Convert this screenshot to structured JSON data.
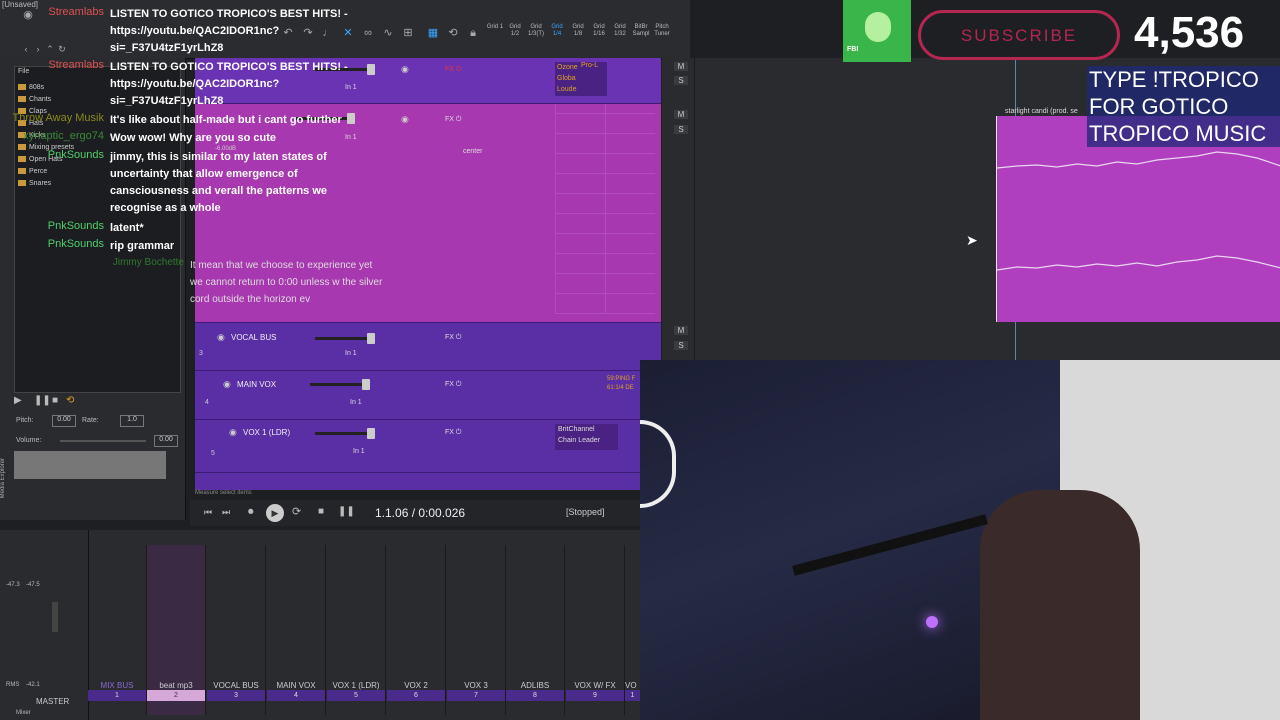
{
  "toolbar": {
    "title": "[Unsaved]",
    "grid_labels": [
      "Grid 1",
      "Grid 1/2",
      "Grid 1/3(T)",
      "Grid 1/4",
      "Grid 1/8",
      "Grid 1/16",
      "Grid 1/32",
      "BitBr Sampl",
      "Pitch Tuner"
    ]
  },
  "browser": {
    "tab": "File",
    "folders": [
      "808s",
      "Chants",
      "Claps",
      "Hats",
      "Kicks",
      "Mixing presets",
      "Open Hats",
      "Perce",
      "Snares"
    ],
    "pitch_label": "Pitch:",
    "pitch_value": "0.00",
    "rate_label": "Rate:",
    "rate_value": "1.0",
    "volume_label": "Volume:",
    "volume_value": "0.00",
    "side_label": "Media Explorer"
  },
  "chat": [
    {
      "name": "Streamlabs",
      "message": "LISTEN TO GOTICO TROPICO'S BEST HITS! - https://youtu.be/QAC2IDOR1nc?si=_F37U4tzF1yrLhZ8"
    },
    {
      "name": "Streamlabs",
      "message": "LISTEN TO GOTICO TROPICO'S BEST HITS! - https://youtu.be/QAC2IDOR1nc?si=_F37U4tzF1yrLhZ8"
    },
    {
      "name": "Throw Away Musik",
      "message": "It's like about half-made but i cant go further"
    },
    {
      "name": "xynaptic_ergo74",
      "message": "Wow wow! Why are you so cute"
    },
    {
      "name": "PnkSounds",
      "message": "jimmy, this is similar to my laten states of uncertainty that allow emergence of cansciousness and verall the patterns we recognise as a whole"
    },
    {
      "name": "PnkSounds",
      "message": "latent*"
    },
    {
      "name": "PnkSounds",
      "message": "rip grammar"
    },
    {
      "name": "Jimmy Bochette",
      "message": "It mean that we choose to experience yet we cannot return to 0:00 unless w the silver cord outside the horizon ev"
    }
  ],
  "tracks": [
    {
      "num": "",
      "name": "",
      "input": "In 1",
      "plugins": [
        "Ozone",
        "Pro-L",
        "Globa",
        "Loude"
      ]
    },
    {
      "num": "",
      "name": "",
      "input": "In 1",
      "pan": "center",
      "vol": "-6.00dB"
    },
    {
      "num": "3",
      "name": "VOCAL BUS",
      "input": "In 1"
    },
    {
      "num": "4",
      "name": "MAIN VOX",
      "input": "In 1",
      "plugins": [
        "59:PING F",
        "61:1/4 DE"
      ]
    },
    {
      "num": "5",
      "name": "VOX 1 (LDR)",
      "input": "In 1",
      "plugins": [
        "BritChannel",
        "Chain Leader"
      ]
    }
  ],
  "arrange": {
    "clip_label": "starlight candi (prod. se",
    "hint": "Measure select items"
  },
  "transport": {
    "position": "1.1.06 / 0:00.026",
    "status": "[Stopped]"
  },
  "mixer": {
    "master_label": "MASTER",
    "rms_label": "RMS",
    "rms_value": "-42.1",
    "peak_left": "-47.3",
    "peak_right": "-47.5",
    "tab": "Mixer",
    "strips": [
      {
        "name": "MIX BUS",
        "num": "1"
      },
      {
        "name": "beat mp3",
        "num": "2"
      },
      {
        "name": "VOCAL BUS",
        "num": "3"
      },
      {
        "name": "MAIN VOX",
        "num": "4"
      },
      {
        "name": "VOX 1 (LDR)",
        "num": "5"
      },
      {
        "name": "VOX 2",
        "num": "6"
      },
      {
        "name": "VOX 3",
        "num": "7"
      },
      {
        "name": "ADLIBS",
        "num": "8"
      },
      {
        "name": "VOX W/ FX",
        "num": "9"
      },
      {
        "name": "VO",
        "num": "1"
      }
    ]
  },
  "overlay": {
    "subscribe_label": "SUBSCRIBE",
    "sub_count": "4,536",
    "tropico_text": "TYPE !TROPICO FOR GOTICO TROPICO MUSIC",
    "avatar_badge": "FBI"
  },
  "colors": {
    "track_purple": "#5a2fa5",
    "track_magenta": "#a838b0",
    "chat_name_green": "#4fcf6a",
    "streamlabs_red": "#e05050",
    "subscribe_red": "#b52650"
  }
}
